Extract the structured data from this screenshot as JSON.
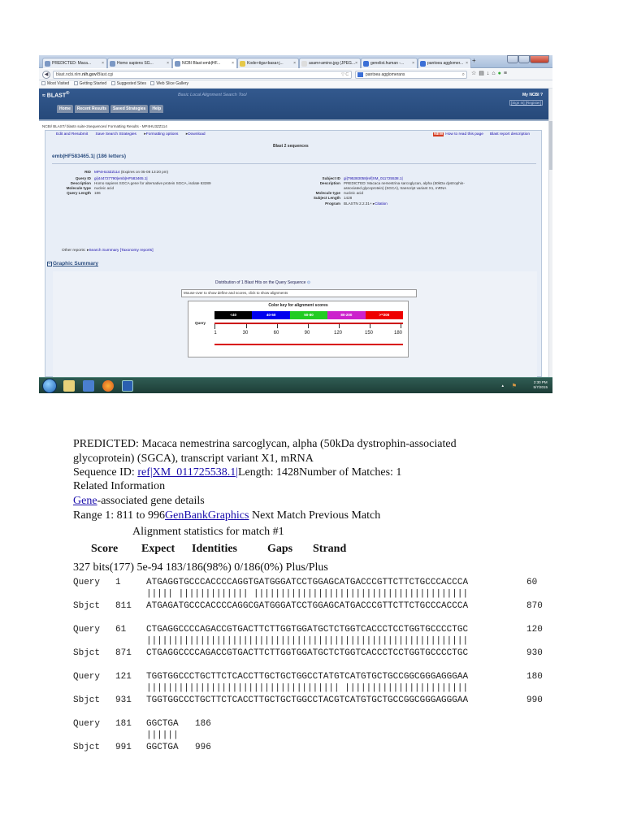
{
  "browser": {
    "tabs": [
      "PREDICTED: Maca...",
      "Homo sapiens SG...",
      "NCBI Blast:emb|HF...",
      "Kode+tiga+basa+j...",
      "asam+amino.jpg (JPEG...",
      "genelist.human -...",
      "pantoea agglomer..."
    ],
    "new_tab": "+",
    "url_prefix": "blast.ncbi.nlm.",
    "url_domain": "nih.gov",
    "url_path": "/Blast.cgi",
    "search_value": "pantoea agglomerans",
    "bookmarks": [
      "Most Visited",
      "Getting Started",
      "Suggested Sites",
      "Web Slice Gallery"
    ]
  },
  "blast": {
    "logo": "BLAST",
    "subtitle": "Basic Local Alignment Search Tool",
    "nav": [
      "Home",
      "Recent Results",
      "Saved Strategies",
      "Help"
    ],
    "my_ncbi": "My NCBI",
    "sign_in": "[Sign In] [Register]",
    "breadcrumb": "NCBI/ BLAST/ blastn suite-2sequences/ Formatting Results - MP4HU3ZZ114",
    "links_left": [
      "Edit and Resubmit",
      "Save Search Strategies",
      "Formatting options",
      "Download"
    ],
    "new_badge": "NEW",
    "links_right": [
      "How to read this page",
      "Blast report description"
    ],
    "blast2_label": "Blast 2 sequences",
    "query_header": "emb|HF583465.1| (186 letters)",
    "rid_label": "RID",
    "rid_link": "MP4HU3ZZ114",
    "rid_rest": "(Expires on 05-08 13:20 pm)",
    "query_id_label": "Query ID",
    "query_id": "gi|444727790|emb|HF583465.1|",
    "desc_label": "Description",
    "query_desc": "Homo sapiens SGCA gene for alternative protein SGCA, isolate 63289",
    "moltype_label": "Molecule type",
    "query_moltype": "nucleic acid",
    "qlen_label": "Query Length",
    "query_length": "186",
    "subject_id_label": "Subject ID",
    "subject_id": "gi|795383058|ref|XM_011725538.1|",
    "subject_desc_1": "PREDICTED: Macaca nemestrina sarcoglycan, alpha (50kDa dystrophin-",
    "subject_desc_2": "associated glycoprotein) (SGCA), transcript variant X1, mRNA",
    "subject_moltype": "nucleic acid",
    "slen_label": "Subject Length",
    "subject_length": "1428",
    "program_label": "Program",
    "program": "BLASTN 2.2.31+",
    "citation": "Citation",
    "other_reports": "Other reports:",
    "other_links": "Search Summary [Taxonomy reports]",
    "graphic_summary": "Graphic Summary",
    "distribution": "Distribution of 1 Blast Hits on the Query Sequence",
    "mouse_over": "Mouse-over to show define and scores, click to show alignments",
    "color_key_title": "Color key for alignment scores",
    "color_key": [
      {
        "label": "<40",
        "color": "#000000"
      },
      {
        "label": "40-50",
        "color": "#0000ee"
      },
      {
        "label": "50-80",
        "color": "#22cc22"
      },
      {
        "label": "80-200",
        "color": "#cc22cc"
      },
      {
        "label": ">=200",
        "color": "#ee0000"
      }
    ],
    "query_axis_label": "Query",
    "ticks": [
      "1",
      "30",
      "60",
      "90",
      "120",
      "150",
      "180"
    ]
  },
  "taskbar": {
    "time": "2:30 PM",
    "date": "5/7/2015"
  },
  "doc": {
    "line1": "PREDICTED: Macaca nemestrina sarcoglycan, alpha (50kDa dystrophin-associated",
    "line2": "glycoprotein) (SGCA), transcript variant X1, mRNA",
    "seq_id_prefix": "Sequence ID: ",
    "seq_id_link": "ref|XM_011725538.1|",
    "seq_id_rest": "Length: 1428Number of Matches: 1",
    "related": "Related Information",
    "gene_link": "Gene",
    "gene_rest": "-associated gene details",
    "range_prefix": "Range 1: 811 to 996",
    "genbank_link": "GenBank",
    "graphics_link": "Graphics",
    "range_rest": " Next Match Previous Match",
    "align_stats": "Alignment statistics for match #1",
    "headers": [
      "Score",
      "Expect",
      "Identities",
      "Gaps",
      "Strand"
    ],
    "stats": "327 bits(177) 5e-94    183/186(98%) 0/186(0%) Plus/Plus",
    "alignment": [
      {
        "q_label": "Query",
        "q_start": "1",
        "q_seq": "ATGAGGTGCCCACCCCAGGTGATGGGATCCTGGAGCATGACCCGTTCTTCTGCCCACCCA",
        "q_end": "60",
        "match": "||||| ||||||||||||| ||||||||||||||||||||||||||||||||||||||||",
        "s_label": "Sbjct",
        "s_start": "811",
        "s_seq": "ATGAGATGCCCACCCCAGGCGATGGGATCCTGGAGCATGACCCGTTCTTCTGCCCACCCA",
        "s_end": "870"
      },
      {
        "q_label": "Query",
        "q_start": "61",
        "q_seq": "CTGAGGCCCCAGACCGTGACTTCTTGGTGGATGCTCTGGTCACCCTCCTGGTGCCCCTGC",
        "q_end": "120",
        "match": "||||||||||||||||||||||||||||||||||||||||||||||||||||||||||||",
        "s_label": "Sbjct",
        "s_start": "871",
        "s_seq": "CTGAGGCCCCAGACCGTGACTTCTTGGTGGATGCTCTGGTCACCCTCCTGGTGCCCCTGC",
        "s_end": "930"
      },
      {
        "q_label": "Query",
        "q_start": "121",
        "q_seq": "TGGTGGCCCTGCTTCTCACCTTGCTGCTGGCCTATGTCATGTGCTGCCGGCGGGAGGGAA",
        "q_end": "180",
        "match": "|||||||||||||||||||||||||||||||||||| |||||||||||||||||||||||",
        "s_label": "Sbjct",
        "s_start": "931",
        "s_seq": "TGGTGGCCCTGCTTCTCACCTTGCTGCTGGCCTACGTCATGTGCTGCCGGCGGGAGGGAA",
        "s_end": "990"
      },
      {
        "q_label": "Query",
        "q_start": "181",
        "q_seq": "GGCTGA",
        "q_end": "186",
        "match": "||||||",
        "s_label": "Sbjct",
        "s_start": "991",
        "s_seq": "GGCTGA",
        "s_end": "996"
      }
    ]
  }
}
